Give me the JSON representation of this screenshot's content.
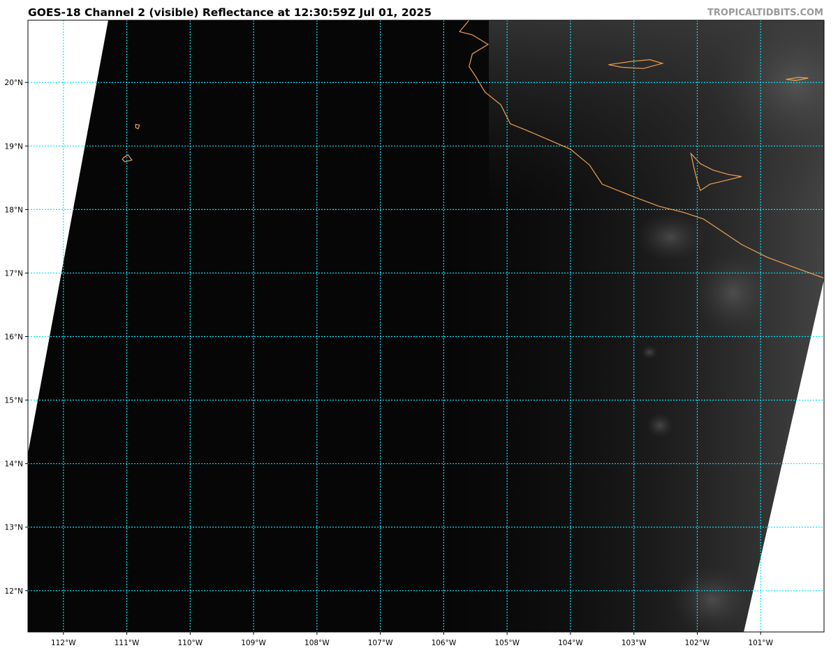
{
  "header": {
    "title": "GOES-18 Channel 2 (visible) Reflectance at 12:30:59Z Jul 01, 2025",
    "credit": "TROPICALTIDBITS.COM"
  },
  "map": {
    "projection": "lat-lon",
    "lon_range": [
      -112.56,
      -100.0
    ],
    "lat_range": [
      11.35,
      20.98
    ],
    "lon_ticks": [
      {
        "value": -112,
        "label": "112°W"
      },
      {
        "value": -111,
        "label": "111°W"
      },
      {
        "value": -110,
        "label": "110°W"
      },
      {
        "value": -109,
        "label": "109°W"
      },
      {
        "value": -108,
        "label": "108°W"
      },
      {
        "value": -107,
        "label": "107°W"
      },
      {
        "value": -106,
        "label": "106°W"
      },
      {
        "value": -105,
        "label": "105°W"
      },
      {
        "value": -104,
        "label": "104°W"
      },
      {
        "value": -103,
        "label": "103°W"
      },
      {
        "value": -102,
        "label": "102°W"
      },
      {
        "value": -101,
        "label": "101°W"
      }
    ],
    "lat_ticks": [
      {
        "value": 20,
        "label": "20°N"
      },
      {
        "value": 19,
        "label": "19°N"
      },
      {
        "value": 18,
        "label": "18°N"
      },
      {
        "value": 17,
        "label": "17°N"
      },
      {
        "value": 16,
        "label": "16°N"
      },
      {
        "value": 15,
        "label": "15°N"
      },
      {
        "value": 14,
        "label": "14°N"
      },
      {
        "value": 13,
        "label": "13°N"
      },
      {
        "value": 12,
        "label": "12°N"
      }
    ],
    "colors": {
      "gridlines": "#00e5ff",
      "coastline": "#f0a050",
      "no_data": "#ffffff",
      "ocean": "#060606",
      "cloud": "#5a5a5a"
    },
    "gridlines": true,
    "coastline_mexico": [
      [
        -105.6,
        20.98
      ],
      [
        -105.75,
        20.8
      ],
      [
        -105.55,
        20.75
      ],
      [
        -105.3,
        20.6
      ],
      [
        -105.55,
        20.45
      ],
      [
        -105.6,
        20.25
      ],
      [
        -105.5,
        20.1
      ],
      [
        -105.35,
        19.85
      ],
      [
        -105.1,
        19.65
      ],
      [
        -104.95,
        19.35
      ],
      [
        -104.7,
        19.25
      ],
      [
        -104.35,
        19.1
      ],
      [
        -104.0,
        18.95
      ],
      [
        -103.7,
        18.7
      ],
      [
        -103.5,
        18.4
      ],
      [
        -103.0,
        18.2
      ],
      [
        -102.6,
        18.05
      ],
      [
        -102.2,
        17.95
      ],
      [
        -101.9,
        17.85
      ],
      [
        -101.6,
        17.65
      ],
      [
        -101.3,
        17.45
      ],
      [
        -100.9,
        17.25
      ],
      [
        -100.5,
        17.1
      ],
      [
        -100.0,
        16.92
      ]
    ],
    "islands": [
      [
        [
          -110.86,
          19.34
        ],
        [
          -110.8,
          19.33
        ],
        [
          -110.82,
          19.27
        ],
        [
          -110.86,
          19.29
        ]
      ],
      [
        [
          -111.05,
          18.82
        ],
        [
          -110.98,
          18.86
        ],
        [
          -110.92,
          18.78
        ],
        [
          -111.03,
          18.75
        ],
        [
          -111.07,
          18.79
        ]
      ],
      [
        [
          -103.4,
          20.28
        ],
        [
          -103.05,
          20.33
        ],
        [
          -102.75,
          20.36
        ],
        [
          -102.55,
          20.3
        ],
        [
          -102.85,
          20.22
        ],
        [
          -103.2,
          20.24
        ]
      ],
      [
        [
          -100.6,
          20.05
        ],
        [
          -100.4,
          20.08
        ],
        [
          -100.25,
          20.07
        ],
        [
          -100.45,
          20.03
        ]
      ]
    ],
    "lake": [
      [
        -102.1,
        18.88
      ],
      [
        -101.95,
        18.72
      ],
      [
        -101.75,
        18.62
      ],
      [
        -101.5,
        18.55
      ],
      [
        -101.3,
        18.52
      ],
      [
        -101.5,
        18.47
      ],
      [
        -101.8,
        18.4
      ],
      [
        -101.95,
        18.3
      ],
      [
        -102.0,
        18.45
      ],
      [
        -102.05,
        18.65
      ]
    ]
  }
}
